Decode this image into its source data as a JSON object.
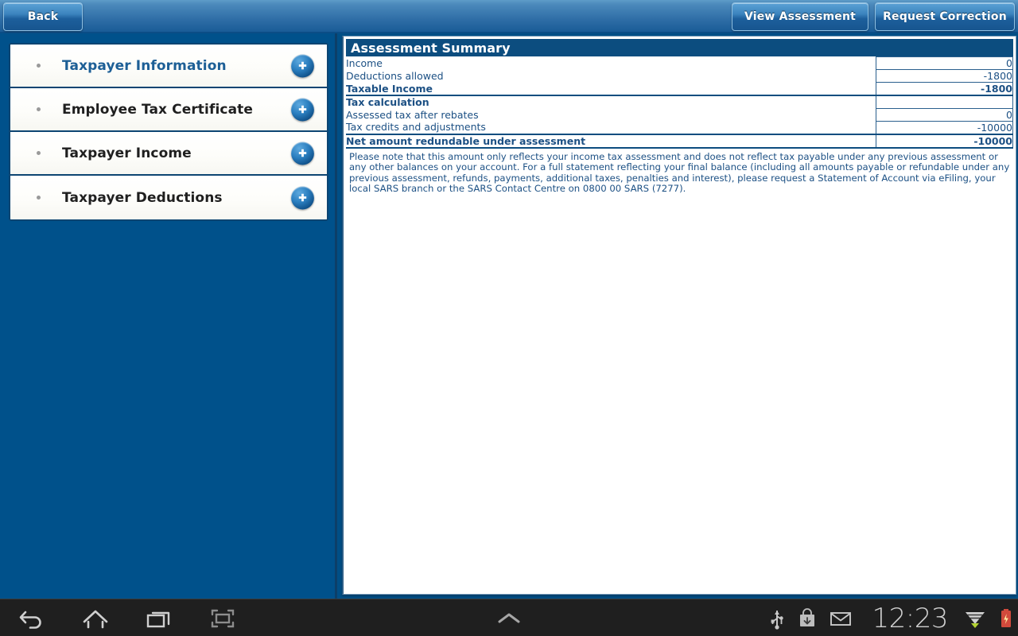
{
  "topbar": {
    "back_label": "Back",
    "view_assessment_label": "View Assessment",
    "request_correction_label": "Request Correction"
  },
  "sidebar": {
    "items": [
      {
        "label": "Taxpayer Information",
        "expand_icon": "plus-circle-icon",
        "active": true
      },
      {
        "label": "Employee Tax Certificate",
        "expand_icon": "plus-circle-icon",
        "active": false
      },
      {
        "label": "Taxpayer Income",
        "expand_icon": "plus-circle-icon",
        "active": false
      },
      {
        "label": "Taxpayer Deductions",
        "expand_icon": "plus-circle-icon",
        "active": false
      }
    ]
  },
  "main": {
    "title": "Assessment Summary",
    "rows": [
      {
        "label": "Income",
        "value": "0",
        "bold": false,
        "group_start": false
      },
      {
        "label": "Deductions allowed",
        "value": "-1800",
        "bold": false,
        "group_start": false
      },
      {
        "label": "Taxable Income",
        "value": "-1800",
        "bold": true,
        "group_start": false
      },
      {
        "label": "Tax calculation",
        "value": "",
        "bold": true,
        "group_start": true
      },
      {
        "label": "Assessed tax after rebates",
        "value": "0",
        "bold": false,
        "group_start": false
      },
      {
        "label": "Tax credits and adjustments",
        "value": "-10000",
        "bold": false,
        "group_start": false
      },
      {
        "label": "Net amount redundable under assessment",
        "value": "-10000",
        "bold": true,
        "group_start": false
      }
    ],
    "note": "Please note that this amount only reflects your income tax assessment and does not reflect tax payable under any previous assessment or any other balances on your account. For a full statement reflecting your final balance (including all amounts payable or refundable under any previous assessment, refunds, payments, additional taxes, penalties and interest), please request a Statement of Account via eFiling, your local SARS branch or the SARS Contact Centre on 0800 00 SARS (7277)."
  },
  "navbar": {
    "back_icon": "back-arrow-icon",
    "home_icon": "home-icon",
    "recents_icon": "recent-apps-icon",
    "screenshot_icon": "screenshot-icon",
    "expand_icon": "chevron-up-icon",
    "usb_icon": "usb-icon",
    "download_icon": "download-icon",
    "mail_icon": "mail-icon",
    "clock": "12:23",
    "wifi_icon": "wifi-icon",
    "battery_icon": "battery-icon"
  },
  "colors": {
    "brand_blue": "#00518b",
    "header_blue": "#0c4d7f",
    "text_blue": "#1c5084",
    "accent_light": "#5ba2d6"
  }
}
